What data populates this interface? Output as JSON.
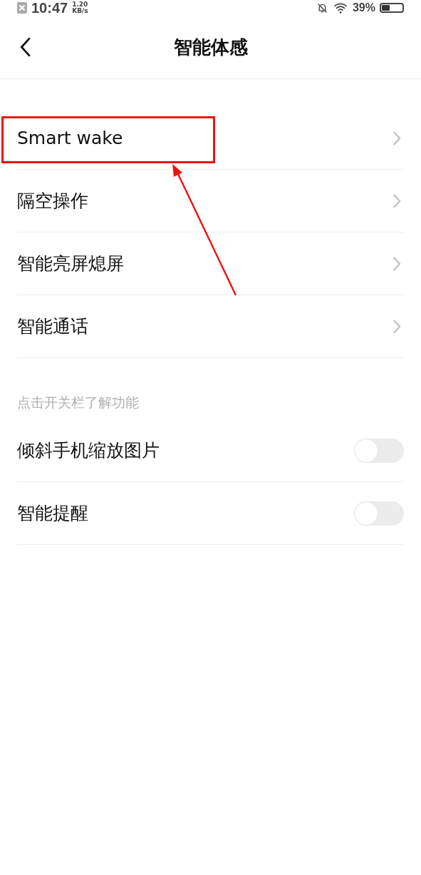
{
  "status_bar": {
    "time": "10:47",
    "net_speed": "1.20",
    "net_unit": "KB/s",
    "battery": "39%"
  },
  "header": {
    "title": "智能体感"
  },
  "nav_items": [
    {
      "label": "Smart wake",
      "highlighted": true
    },
    {
      "label": "隔空操作",
      "highlighted": false
    },
    {
      "label": "智能亮屏熄屏",
      "highlighted": false
    },
    {
      "label": "智能通话",
      "highlighted": false
    }
  ],
  "section": {
    "caption": "点击开关栏了解功能"
  },
  "toggle_items": [
    {
      "label": "倾斜手机缩放图片",
      "on": false
    },
    {
      "label": "智能提醒",
      "on": false
    }
  ]
}
